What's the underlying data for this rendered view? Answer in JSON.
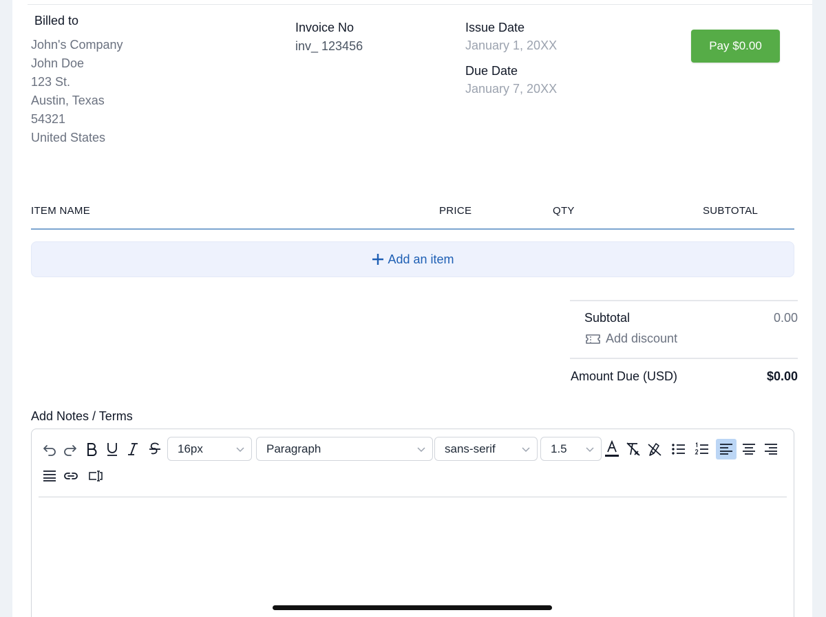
{
  "billed_to": {
    "label": "Billed to",
    "company": "John's Company",
    "name": "John Doe",
    "street": "123 St.",
    "city_state": "Austin, Texas",
    "zip": "54321",
    "country": "United States"
  },
  "invoice": {
    "label": "Invoice No",
    "value": "inv_ 123456"
  },
  "issue_date": {
    "label": "Issue Date",
    "value": "January 1, 20XX"
  },
  "due_date": {
    "label": "Due Date",
    "value": "January 7, 20XX"
  },
  "pay_button": {
    "label": "Pay $0.00",
    "color": "#56ac47"
  },
  "table": {
    "headers": [
      "ITEM NAME",
      "PRICE",
      "QTY",
      "SUBTOTAL"
    ],
    "add_item_label": "Add an item",
    "add_item_icon": "plus-icon"
  },
  "totals": {
    "subtotal_label": "Subtotal",
    "subtotal_value": "0.00",
    "discount_label": "Add discount",
    "discount_icon": "ticket-icon",
    "amount_due_label": "Amount Due (USD)",
    "amount_due_value": "$0.00"
  },
  "notes": {
    "label": "Add Notes / Terms",
    "toolbar": {
      "font_size": "16px",
      "block_type": "Paragraph",
      "font_family": "sans-serif",
      "line_height": "1.5",
      "active_alignment": "align-left"
    }
  },
  "colors": {
    "accent": "#1e5fb4",
    "header_rule": "#5b8fc4"
  }
}
